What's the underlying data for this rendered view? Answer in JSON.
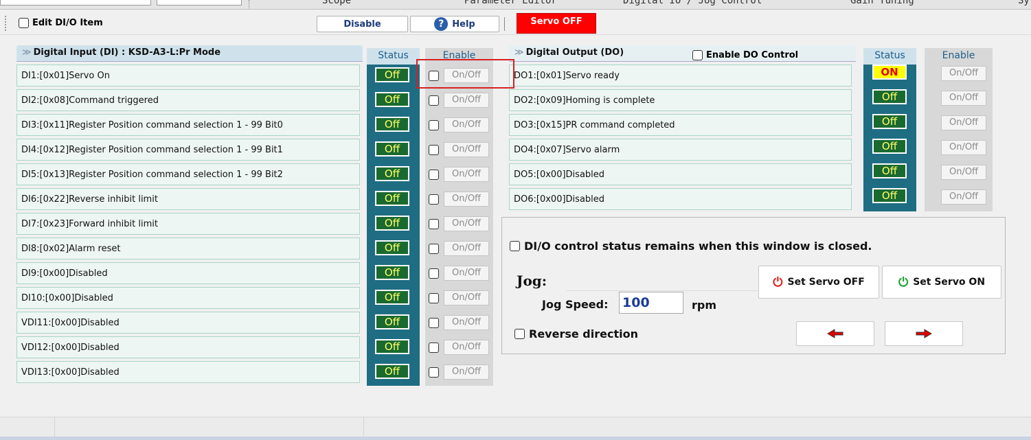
{
  "tabs": [
    "Scope",
    "Parameter Editor",
    "Digital IO / Jog Control",
    "Gain Tuning",
    "Sy"
  ],
  "toolbar": {
    "edit_label": "Edit DI/O Item",
    "disable_label": "Disable",
    "help_label": "Help",
    "servo_state": "Servo OFF"
  },
  "di_panel": {
    "title": "Digital Input (DI) : KSD-A3-L:Pr Mode",
    "status_header": "Status",
    "enable_header": "Enable",
    "rows": [
      {
        "label": "DI1:[0x01]Servo On",
        "status": "Off",
        "enable": "On/Off"
      },
      {
        "label": "DI2:[0x08]Command triggered",
        "status": "Off",
        "enable": "On/Off"
      },
      {
        "label": "DI3:[0x11]Register Position command selection 1 - 99 Bit0",
        "status": "Off",
        "enable": "On/Off"
      },
      {
        "label": "DI4:[0x12]Register Position command selection 1 - 99 Bit1",
        "status": "Off",
        "enable": "On/Off"
      },
      {
        "label": "DI5:[0x13]Register Position command selection 1 - 99 Bit2",
        "status": "Off",
        "enable": "On/Off"
      },
      {
        "label": "DI6:[0x22]Reverse inhibit limit",
        "status": "Off",
        "enable": "On/Off"
      },
      {
        "label": "DI7:[0x23]Forward inhibit limit",
        "status": "Off",
        "enable": "On/Off"
      },
      {
        "label": "DI8:[0x02]Alarm reset",
        "status": "Off",
        "enable": "On/Off"
      },
      {
        "label": "DI9:[0x00]Disabled",
        "status": "Off",
        "enable": "On/Off"
      },
      {
        "label": "DI10:[0x00]Disabled",
        "status": "Off",
        "enable": "On/Off"
      },
      {
        "label": "VDI11:[0x00]Disabled",
        "status": "Off",
        "enable": "On/Off"
      },
      {
        "label": "VDI12:[0x00]Disabled",
        "status": "Off",
        "enable": "On/Off"
      },
      {
        "label": "VDI13:[0x00]Disabled",
        "status": "Off",
        "enable": "On/Off"
      }
    ]
  },
  "do_panel": {
    "title": "Digital Output (DO)",
    "enable_control_label": "Enable DO Control",
    "status_header": "Status",
    "enable_header": "Enable",
    "rows": [
      {
        "label": "DO1:[0x01]Servo ready",
        "status": "ON",
        "enable": "On/Off"
      },
      {
        "label": "DO2:[0x09]Homing is complete",
        "status": "Off",
        "enable": "On/Off"
      },
      {
        "label": "DO3:[0x15]PR command completed",
        "status": "Off",
        "enable": "On/Off"
      },
      {
        "label": "DO4:[0x07]Servo alarm",
        "status": "Off",
        "enable": "On/Off"
      },
      {
        "label": "DO5:[0x00]Disabled",
        "status": "Off",
        "enable": "On/Off"
      },
      {
        "label": "DO6:[0x00]Disabled",
        "status": "Off",
        "enable": "On/Off"
      }
    ]
  },
  "control": {
    "remain_label": "DI/O control status remains when this window is closed.",
    "jog_title": "Jog:",
    "jog_speed_label": "Jog Speed:",
    "jog_speed_value": "100",
    "jog_unit": "rpm",
    "reverse_label": "Reverse direction",
    "servo_off_btn": "Set Servo OFF",
    "servo_on_btn": "Set Servo ON"
  },
  "colors": {
    "status_column": "#1f6d82",
    "off_badge": "#1a6a30",
    "on_badge": "#ffff00",
    "servo_off_bg": "#ff0000",
    "highlight": "#d82020"
  }
}
